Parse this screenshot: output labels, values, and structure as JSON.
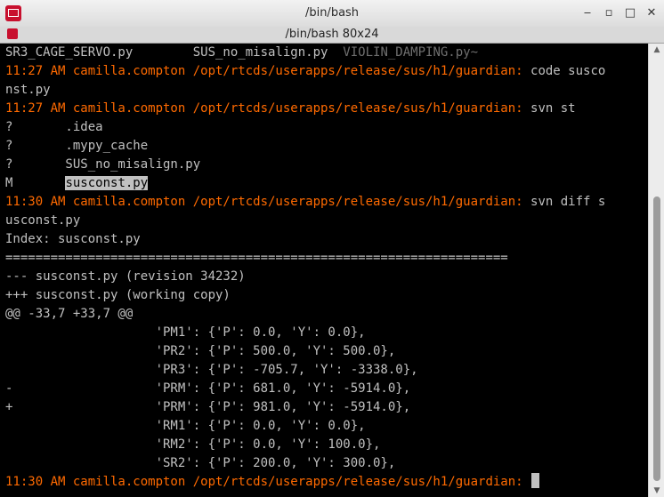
{
  "window": {
    "title": "/bin/bash",
    "controls": {
      "minimize": "‒",
      "restore": "▫",
      "maximize": "□",
      "close": "✕"
    }
  },
  "tab": {
    "title": "/bin/bash 80x24"
  },
  "terminal": {
    "lines": [
      {
        "segments": [
          {
            "text": "SR3_CAGE_SERVO.py        SUS_no_misalign.py  "
          },
          {
            "text": "VIOLIN_DAMPING.py~",
            "style": "dim"
          }
        ]
      },
      {
        "segments": [
          {
            "text": "11:27 AM camilla.compton /opt/rtcds/userapps/release/sus/h1/guardian: ",
            "style": "prompt"
          },
          {
            "text": "code susco"
          }
        ]
      },
      {
        "segments": [
          {
            "text": "nst.py"
          }
        ]
      },
      {
        "segments": [
          {
            "text": "11:27 AM camilla.compton /opt/rtcds/userapps/release/sus/h1/guardian: ",
            "style": "prompt"
          },
          {
            "text": "svn st"
          }
        ]
      },
      {
        "segments": [
          {
            "text": "?       .idea"
          }
        ]
      },
      {
        "segments": [
          {
            "text": "?       .mypy_cache"
          }
        ]
      },
      {
        "segments": [
          {
            "text": "?       SUS_no_misalign.py"
          }
        ]
      },
      {
        "segments": [
          {
            "text": "M       "
          },
          {
            "text": "susconst.py",
            "style": "sel"
          }
        ]
      },
      {
        "segments": [
          {
            "text": "11:30 AM camilla.compton /opt/rtcds/userapps/release/sus/h1/guardian: ",
            "style": "prompt"
          },
          {
            "text": "svn diff s"
          }
        ]
      },
      {
        "segments": [
          {
            "text": "usconst.py"
          }
        ]
      },
      {
        "segments": [
          {
            "text": "Index: susconst.py"
          }
        ]
      },
      {
        "segments": [
          {
            "text": "==================================================================="
          }
        ]
      },
      {
        "segments": [
          {
            "text": "--- susconst.py (revision 34232)"
          }
        ]
      },
      {
        "segments": [
          {
            "text": "+++ susconst.py (working copy)"
          }
        ]
      },
      {
        "segments": [
          {
            "text": "@@ -33,7 +33,7 @@"
          }
        ]
      },
      {
        "segments": [
          {
            "text": "                    'PM1': {'P': 0.0, 'Y': 0.0},"
          }
        ]
      },
      {
        "segments": [
          {
            "text": "                    'PR2': {'P': 500.0, 'Y': 500.0},"
          }
        ]
      },
      {
        "segments": [
          {
            "text": "                    'PR3': {'P': -705.7, 'Y': -3338.0},"
          }
        ]
      },
      {
        "segments": [
          {
            "text": "-                   'PRM': {'P': 681.0, 'Y': -5914.0},"
          }
        ]
      },
      {
        "segments": [
          {
            "text": "+                   'PRM': {'P': 981.0, 'Y': -5914.0},"
          }
        ]
      },
      {
        "segments": [
          {
            "text": "                    'RM1': {'P': 0.0, 'Y': 0.0},"
          }
        ]
      },
      {
        "segments": [
          {
            "text": "                    'RM2': {'P': 0.0, 'Y': 100.0},"
          }
        ]
      },
      {
        "segments": [
          {
            "text": "                    'SR2': {'P': 200.0, 'Y': 300.0},"
          }
        ]
      },
      {
        "segments": [
          {
            "text": "11:30 AM camilla.compton /opt/rtcds/userapps/release/sus/h1/guardian: ",
            "style": "prompt"
          }
        ],
        "cursor": true
      }
    ]
  },
  "colors": {
    "background": "#000000",
    "foreground": "#c0c0c0",
    "prompt": "#ff6a00",
    "dim": "#6f6f6f"
  },
  "icons": {
    "app": "terminal-app-icon",
    "tab": "terminal-tab-icon",
    "scroll_up": "arrow-up-icon",
    "scroll_down": "arrow-down-icon"
  }
}
